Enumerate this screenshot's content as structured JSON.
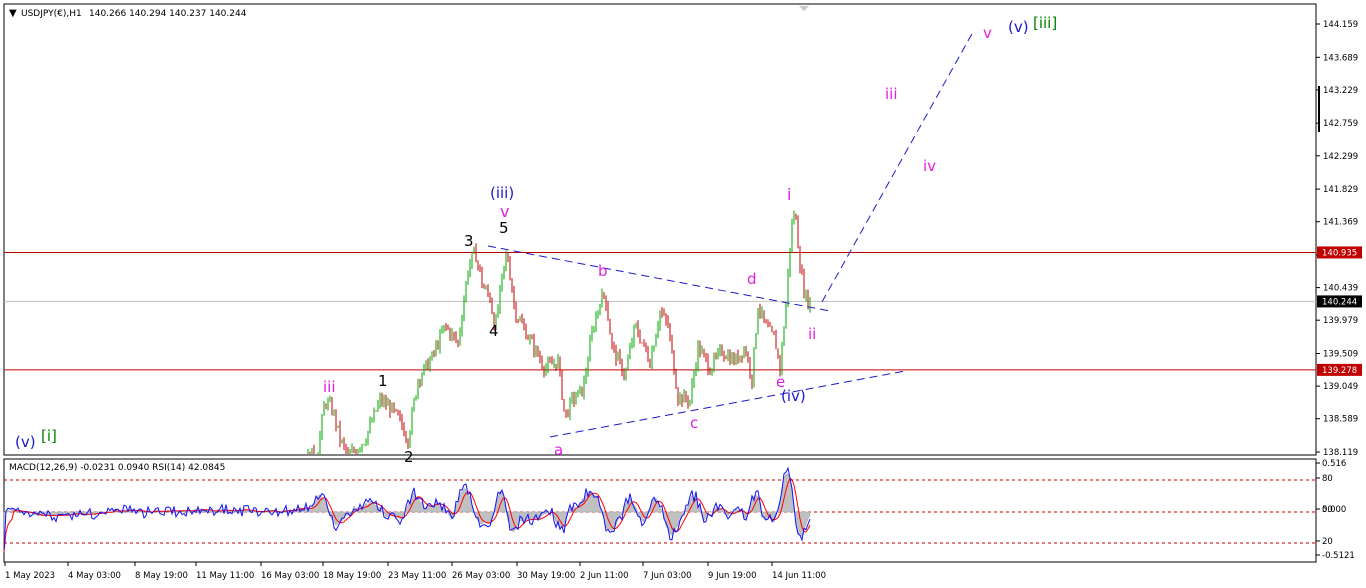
{
  "header": {
    "symbol": "USDJPY(€),H1",
    "ohlc": "140.266 140.294 140.237 140.244"
  },
  "indicator": {
    "title": "MACD(12,26,9) -0.0231 0.0940  RSI(14) 42.0845",
    "right_labels": [
      "0.516",
      "80",
      "0.000",
      "50",
      "20",
      "-0.5121"
    ]
  },
  "colors": {
    "background": "#ffffff",
    "bull_candle": "#00aa00",
    "bear_candle": "#c00000",
    "hline": "#c00000",
    "wave_blue": "#1a1acc",
    "wave_magenta": "#e020e0",
    "wave_black": "#000000",
    "wave_green": "#008000",
    "histogram": "#c0c0c0",
    "rsi_line": "#1010ff",
    "signal_line": "#ff0000"
  },
  "chart_data": {
    "type": "candlestick",
    "ylim": [
      138.119,
      144.3
    ],
    "y_ticks": [
      "144.159",
      "143.689",
      "143.229",
      "142.759",
      "142.299",
      "141.829",
      "141.369",
      "140.899",
      "140.439",
      "139.979",
      "139.509",
      "139.049",
      "138.589",
      "138.119"
    ],
    "x_ticks": [
      "1 May 2023",
      "4 May 03:00",
      "8 May 19:00",
      "11 May 11:00",
      "16 May 03:00",
      "18 May 19:00",
      "23 May 11:00",
      "26 May 03:00",
      "30 May 19:00",
      "2 Jun 11:00",
      "7 Jun 03:00",
      "9 Jun 19:00",
      "14 Jun 11:00"
    ],
    "current_price": "140.244",
    "price_levels": [
      "140.935",
      "139.278"
    ],
    "price_path": [
      [
        0,
        137.45
      ],
      [
        30,
        137.6
      ],
      [
        60,
        137.2
      ],
      [
        100,
        136.9
      ],
      [
        150,
        137.1
      ],
      [
        200,
        137.4
      ],
      [
        250,
        137.7
      ],
      [
        290,
        137.85
      ],
      [
        318,
        138.15
      ],
      [
        325,
        138.85
      ],
      [
        333,
        138.7
      ],
      [
        340,
        138.3
      ],
      [
        348,
        138.05
      ],
      [
        365,
        138.3
      ],
      [
        380,
        138.85
      ],
      [
        390,
        138.75
      ],
      [
        400,
        138.55
      ],
      [
        408,
        138.3
      ],
      [
        418,
        139.15
      ],
      [
        432,
        139.45
      ],
      [
        445,
        139.9
      ],
      [
        458,
        139.65
      ],
      [
        468,
        140.7
      ],
      [
        475,
        140.95
      ],
      [
        483,
        140.45
      ],
      [
        490,
        140.3
      ],
      [
        495,
        139.85
      ],
      [
        502,
        140.55
      ],
      [
        507,
        140.95
      ],
      [
        515,
        140.1
      ],
      [
        530,
        139.7
      ],
      [
        545,
        139.3
      ],
      [
        558,
        139.4
      ],
      [
        565,
        138.6
      ],
      [
        572,
        138.85
      ],
      [
        583,
        139.0
      ],
      [
        592,
        139.8
      ],
      [
        600,
        140.25
      ],
      [
        605,
        140.35
      ],
      [
        612,
        139.6
      ],
      [
        625,
        139.2
      ],
      [
        635,
        139.9
      ],
      [
        650,
        139.4
      ],
      [
        660,
        140.1
      ],
      [
        668,
        139.9
      ],
      [
        678,
        138.9
      ],
      [
        690,
        138.85
      ],
      [
        698,
        139.6
      ],
      [
        710,
        139.3
      ],
      [
        722,
        139.55
      ],
      [
        735,
        139.4
      ],
      [
        745,
        139.6
      ],
      [
        752,
        139.15
      ],
      [
        758,
        140.2
      ],
      [
        765,
        139.9
      ],
      [
        775,
        139.7
      ],
      [
        780,
        139.3
      ],
      [
        786,
        140.2
      ],
      [
        791,
        141.25
      ],
      [
        795,
        141.55
      ],
      [
        799,
        140.9
      ],
      [
        803,
        140.45
      ],
      [
        807,
        140.25
      ],
      [
        810,
        140.24
      ]
    ],
    "projection": [
      [
        "14 Jun",
        "140.20"
      ],
      [
        "",
        "144.10"
      ]
    ],
    "wave_labels": [
      {
        "text": "(v)",
        "color": "blue"
      },
      {
        "text": "[i]",
        "color": "green"
      },
      {
        "text": "iii",
        "color": "magenta"
      },
      {
        "text": "1",
        "color": "black"
      },
      {
        "text": "2",
        "color": "black"
      },
      {
        "text": "3",
        "color": "black"
      },
      {
        "text": "4",
        "color": "black"
      },
      {
        "text": "5",
        "color": "black"
      },
      {
        "text": "(iii)",
        "color": "blue"
      },
      {
        "text": "v",
        "color": "magenta"
      },
      {
        "text": "a",
        "color": "magenta"
      },
      {
        "text": "b",
        "color": "magenta"
      },
      {
        "text": "c",
        "color": "magenta"
      },
      {
        "text": "d",
        "color": "magenta"
      },
      {
        "text": "e",
        "color": "magenta"
      },
      {
        "text": "(iv)",
        "color": "blue"
      },
      {
        "text": "i",
        "color": "magenta"
      },
      {
        "text": "ii",
        "color": "magenta"
      },
      {
        "text": "iii",
        "color": "magenta"
      },
      {
        "text": "iv",
        "color": "magenta"
      },
      {
        "text": "v",
        "color": "magenta"
      },
      {
        "text": "(v)",
        "color": "blue"
      },
      {
        "text": "[iii]",
        "color": "green"
      }
    ]
  }
}
